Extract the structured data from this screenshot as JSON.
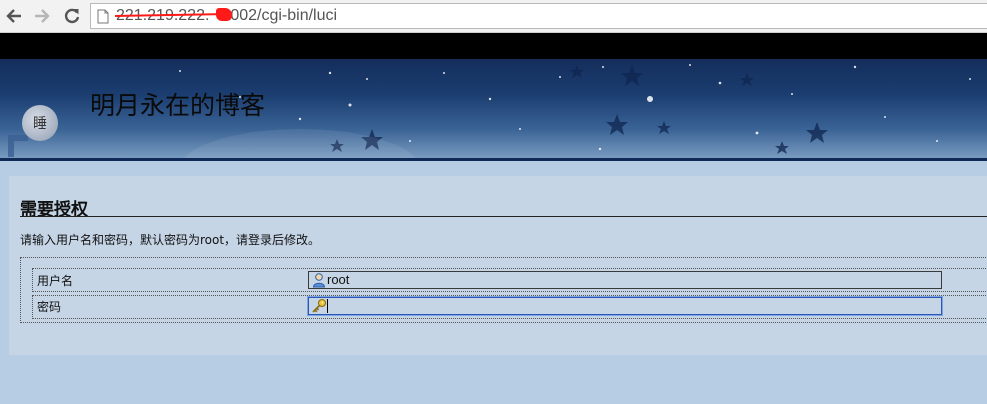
{
  "browser": {
    "url_visible": "221.219.222.",
    "url_rest": "2002/cgi-bin/luci",
    "back_icon": "arrow-left-icon",
    "forward_icon": "arrow-right-icon",
    "reload_icon": "reload-icon",
    "page_icon": "page-icon"
  },
  "header": {
    "site_title": "明月永在的博客",
    "avatar_text": "睡"
  },
  "auth": {
    "title": "需要授权",
    "description": "请输入用户名和密码，默认密码为root，请登录后修改。",
    "username_label": "用户名",
    "username_value": "root",
    "password_label": "密码",
    "password_value": "",
    "user_icon": "user-icon",
    "key_icon": "key-icon"
  },
  "colors": {
    "page_bg": "#b7cde3",
    "panel_bg": "#c5d5e6",
    "banner_top": "#142e5c",
    "focus_border": "#2b58b8",
    "redaction": "#ff1a1a"
  }
}
